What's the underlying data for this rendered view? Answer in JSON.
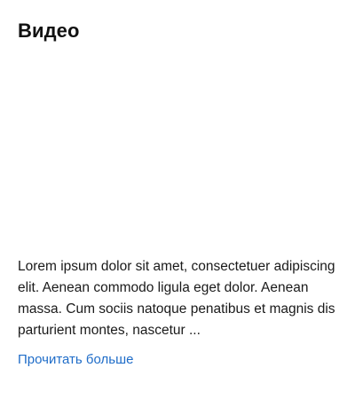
{
  "section": {
    "title": "Видео"
  },
  "description": {
    "text": "Lorem ipsum dolor sit amet, consectetuer adipiscing elit. Aenean commodo ligula eget dolor. Aenean massa. Cum sociis natoque penatibus et magnis dis parturient montes, nascetur ..."
  },
  "actions": {
    "read_more_label": "Прочитать больше"
  },
  "colors": {
    "link": "#1e6cc8",
    "text": "#1a1a1a",
    "background": "#ffffff"
  }
}
